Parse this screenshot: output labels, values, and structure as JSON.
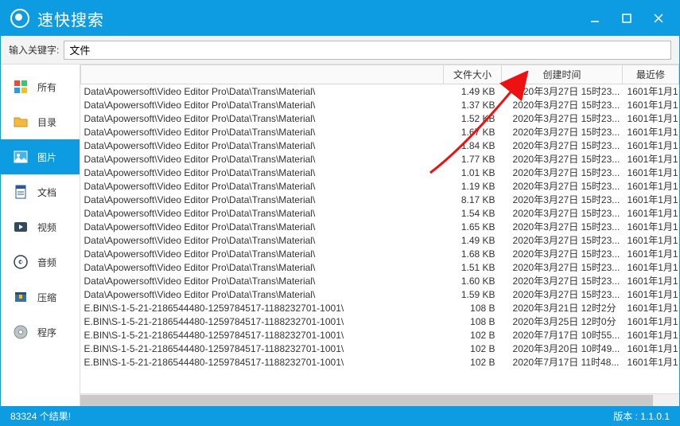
{
  "accent": "#0d9be2",
  "app_title": "速快搜索",
  "window_controls": {
    "min": "minimize",
    "max": "maximize",
    "close": "close"
  },
  "search": {
    "label": "输入关键字:",
    "value": "文件"
  },
  "sidebar": {
    "items": [
      {
        "label": "所有",
        "icon": "grid"
      },
      {
        "label": "目录",
        "icon": "folder"
      },
      {
        "label": "图片",
        "icon": "image"
      },
      {
        "label": "文档",
        "icon": "doc"
      },
      {
        "label": "视频",
        "icon": "video"
      },
      {
        "label": "音频",
        "icon": "audio"
      },
      {
        "label": "压缩",
        "icon": "archive"
      },
      {
        "label": "程序",
        "icon": "disc"
      }
    ],
    "active_index": 2
  },
  "table": {
    "headers": {
      "name": "",
      "size": "文件大小",
      "ctime": "创建时间",
      "mtime": "最近修"
    },
    "rows": [
      {
        "name": "Data\\Apowersoft\\Video Editor Pro\\Data\\Trans\\Material\\",
        "size": "1.49 KB",
        "ctime": "2020年3月27日 15时23...",
        "mtime": "1601年1月1"
      },
      {
        "name": "Data\\Apowersoft\\Video Editor Pro\\Data\\Trans\\Material\\",
        "size": "1.37 KB",
        "ctime": "2020年3月27日 15时23...",
        "mtime": "1601年1月1"
      },
      {
        "name": "Data\\Apowersoft\\Video Editor Pro\\Data\\Trans\\Material\\",
        "size": "1.52 KB",
        "ctime": "2020年3月27日 15时23...",
        "mtime": "1601年1月1"
      },
      {
        "name": "Data\\Apowersoft\\Video Editor Pro\\Data\\Trans\\Material\\",
        "size": "1.67 KB",
        "ctime": "2020年3月27日 15时23...",
        "mtime": "1601年1月1"
      },
      {
        "name": "Data\\Apowersoft\\Video Editor Pro\\Data\\Trans\\Material\\",
        "size": "1.84 KB",
        "ctime": "2020年3月27日 15时23...",
        "mtime": "1601年1月1"
      },
      {
        "name": "Data\\Apowersoft\\Video Editor Pro\\Data\\Trans\\Material\\",
        "size": "1.77 KB",
        "ctime": "2020年3月27日 15时23...",
        "mtime": "1601年1月1"
      },
      {
        "name": "Data\\Apowersoft\\Video Editor Pro\\Data\\Trans\\Material\\",
        "size": "1.01 KB",
        "ctime": "2020年3月27日 15时23...",
        "mtime": "1601年1月1"
      },
      {
        "name": "Data\\Apowersoft\\Video Editor Pro\\Data\\Trans\\Material\\",
        "size": "1.19 KB",
        "ctime": "2020年3月27日 15时23...",
        "mtime": "1601年1月1"
      },
      {
        "name": "Data\\Apowersoft\\Video Editor Pro\\Data\\Trans\\Material\\",
        "size": "8.17 KB",
        "ctime": "2020年3月27日 15时23...",
        "mtime": "1601年1月1"
      },
      {
        "name": "Data\\Apowersoft\\Video Editor Pro\\Data\\Trans\\Material\\",
        "size": "1.54 KB",
        "ctime": "2020年3月27日 15时23...",
        "mtime": "1601年1月1"
      },
      {
        "name": "Data\\Apowersoft\\Video Editor Pro\\Data\\Trans\\Material\\",
        "size": "1.65 KB",
        "ctime": "2020年3月27日 15时23...",
        "mtime": "1601年1月1"
      },
      {
        "name": "Data\\Apowersoft\\Video Editor Pro\\Data\\Trans\\Material\\",
        "size": "1.49 KB",
        "ctime": "2020年3月27日 15时23...",
        "mtime": "1601年1月1"
      },
      {
        "name": "Data\\Apowersoft\\Video Editor Pro\\Data\\Trans\\Material\\",
        "size": "1.68 KB",
        "ctime": "2020年3月27日 15时23...",
        "mtime": "1601年1月1"
      },
      {
        "name": "Data\\Apowersoft\\Video Editor Pro\\Data\\Trans\\Material\\",
        "size": "1.51 KB",
        "ctime": "2020年3月27日 15时23...",
        "mtime": "1601年1月1"
      },
      {
        "name": "Data\\Apowersoft\\Video Editor Pro\\Data\\Trans\\Material\\",
        "size": "1.60 KB",
        "ctime": "2020年3月27日 15时23...",
        "mtime": "1601年1月1"
      },
      {
        "name": "Data\\Apowersoft\\Video Editor Pro\\Data\\Trans\\Material\\",
        "size": "1.59 KB",
        "ctime": "2020年3月27日 15时23...",
        "mtime": "1601年1月1"
      },
      {
        "name": "E.BIN\\S-1-5-21-2186544480-1259784517-1188232701-1001\\",
        "size": "108 B",
        "ctime": "2020年3月21日 12时2分",
        "mtime": "1601年1月1"
      },
      {
        "name": "E.BIN\\S-1-5-21-2186544480-1259784517-1188232701-1001\\",
        "size": "108 B",
        "ctime": "2020年3月25日 12时0分",
        "mtime": "1601年1月1"
      },
      {
        "name": "E.BIN\\S-1-5-21-2186544480-1259784517-1188232701-1001\\",
        "size": "102 B",
        "ctime": "2020年7月17日 10时55...",
        "mtime": "1601年1月1"
      },
      {
        "name": "E.BIN\\S-1-5-21-2186544480-1259784517-1188232701-1001\\",
        "size": "102 B",
        "ctime": "2020年3月20日 10时49...",
        "mtime": "1601年1月1"
      },
      {
        "name": "E.BIN\\S-1-5-21-2186544480-1259784517-1188232701-1001\\",
        "size": "102 B",
        "ctime": "2020年7月17日 11时48...",
        "mtime": "1601年1月1"
      }
    ]
  },
  "status": {
    "results": "83324 个结果!",
    "version": "版本 : 1.1.0.1"
  }
}
